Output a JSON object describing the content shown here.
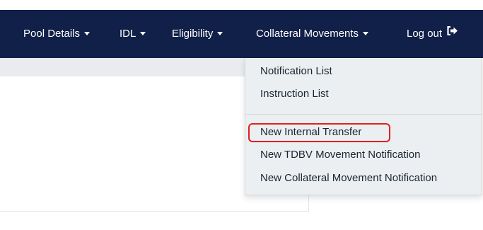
{
  "navbar": {
    "items": [
      {
        "label": "Pool Details",
        "has_caret": true
      },
      {
        "label": "IDL",
        "has_caret": true
      },
      {
        "label": "Eligibility",
        "has_caret": true
      },
      {
        "label": "Collateral Movements",
        "has_caret": true
      }
    ],
    "logout_label": "Log out",
    "background": "#112048",
    "icons": {
      "logout": "sign-out-icon"
    }
  },
  "dropdown": {
    "group1": [
      "Notification List",
      "Instruction List"
    ],
    "group2": [
      "New Internal Transfer",
      "New TDBV Movement Notification",
      "New Collateral Movement Notification"
    ],
    "highlighted": "New Internal Transfer",
    "highlight_color": "#e02020"
  }
}
